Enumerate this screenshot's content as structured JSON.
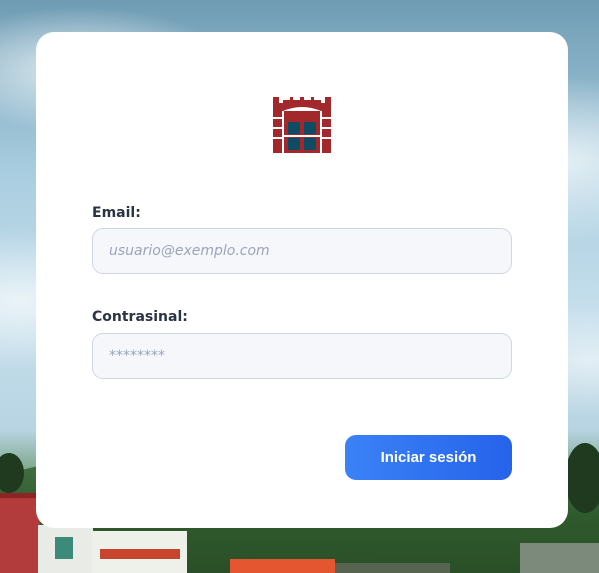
{
  "login": {
    "email_label": "Email:",
    "email_placeholder": "usuario@exemplo.com",
    "email_value": "",
    "password_label": "Contrasinal:",
    "password_placeholder": "********",
    "password_value": "",
    "submit_label": "Iniciar sesión"
  },
  "logo": {
    "icon": "building-logo-icon",
    "color_primary": "#a3282b",
    "color_windows": "#0f4c63"
  },
  "colors": {
    "button_start": "#3b82f6",
    "button_end": "#2563eb",
    "card": "#ffffff"
  }
}
